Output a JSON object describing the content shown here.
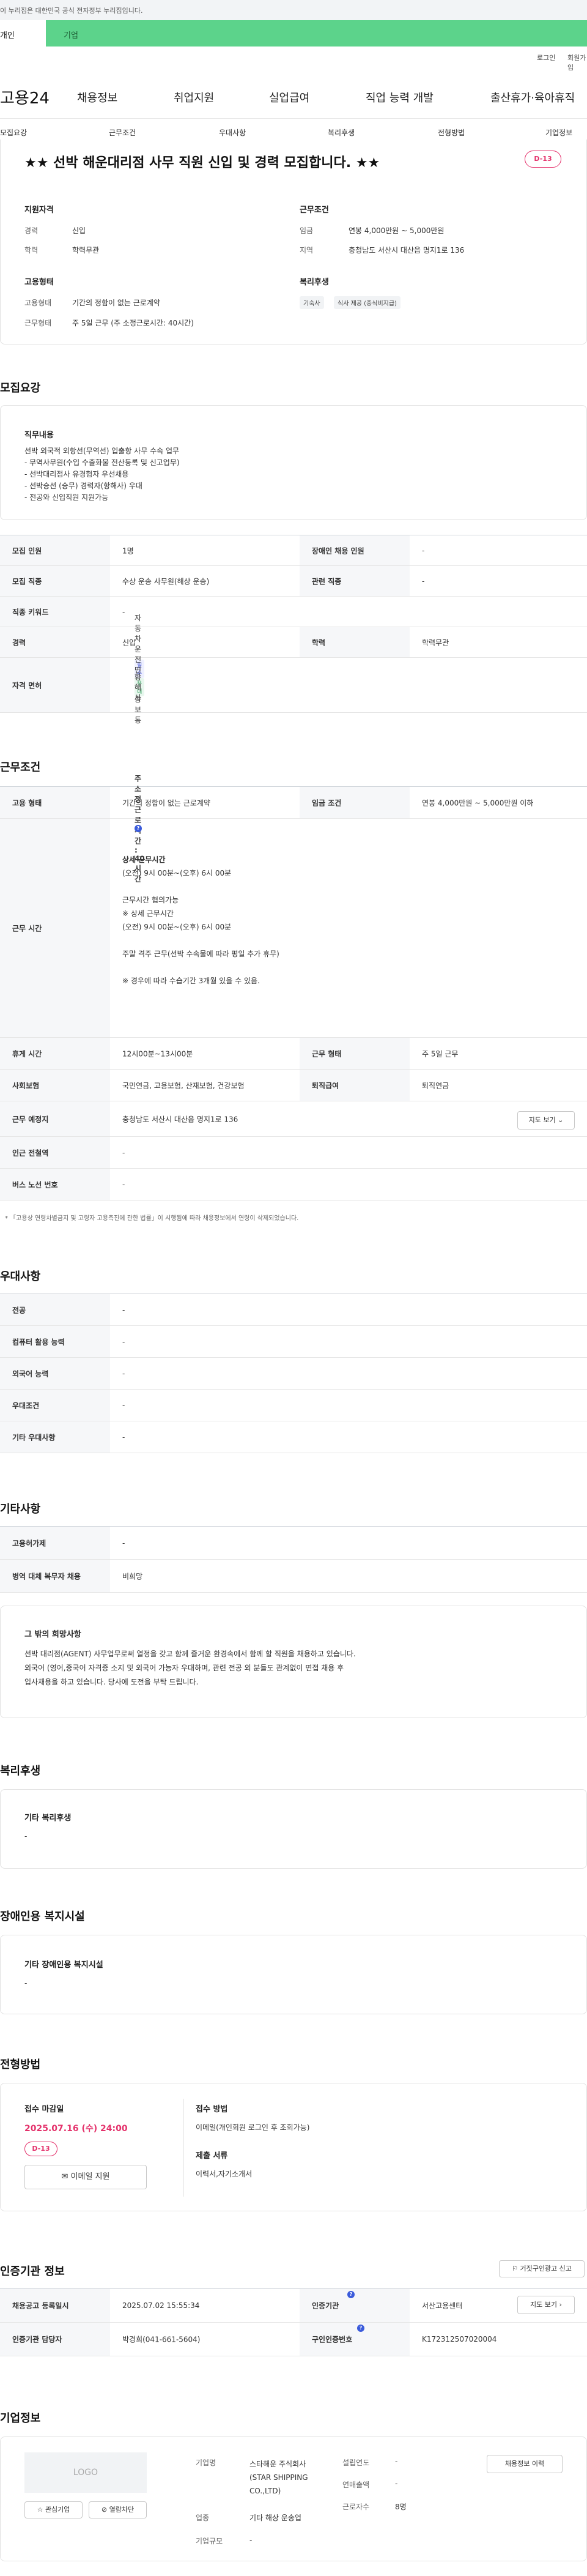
{
  "gov_banner": "이 누리집은 대한민국 공식 전자정부 누리집입니다.",
  "tabs": [
    "개인",
    "기업"
  ],
  "util": [
    "로그인",
    "회원가입"
  ],
  "logo": "고용24",
  "gnb": [
    "채용정보",
    "취업지원",
    "실업급여",
    "직업 능력 개발",
    "출산휴가·육아휴직"
  ],
  "subnav": [
    "모집요강",
    "근무조건",
    "우대사항",
    "복리후생",
    "전형방법",
    "기업정보"
  ],
  "job": {
    "title": "★★ 선박 해운대리점 사무 직원 신입 및 경력 모집합니다. ★★",
    "dday": "D-13",
    "qual_head": "지원자격",
    "qual": [
      {
        "k": "경력",
        "v": "신입"
      },
      {
        "k": "학력",
        "v": "학력무관"
      }
    ],
    "cond_head": "근무조건",
    "cond": [
      {
        "k": "임금",
        "v": "연봉 4,000만원 ~ 5,000만원"
      },
      {
        "k": "지역",
        "v": "충청남도 서산시 대산읍 명지1로 136"
      }
    ],
    "emp_head": "고용형태",
    "emp": [
      {
        "k": "고용형태",
        "v": "기간의 정함이 없는 근로계약"
      },
      {
        "k": "근무형태",
        "v": "주 5일 근무 (주 소정근로시간: 40시간)"
      }
    ],
    "welfare_head": "복리후생",
    "welfare": [
      "기숙사",
      "식사 제공 (중식비지급)"
    ]
  },
  "s1": {
    "title": "모집요강",
    "duty_head": "직무내용",
    "duty": [
      "선박 외국적 외항선(무역선) 입출항 사무 수속 업무",
      "- 무역사무원(수입 수출화물 전산등록 및 신고업무)",
      "- 선박대리점사 유경험자 우선채용",
      "- 선박승선 (승무) 경력자(항해사) 우대",
      "- 전공와 신입직원 지원가능"
    ],
    "rows": [
      {
        "a": "모집 인원",
        "b": "1명",
        "c": "장애인 채용 인원",
        "d": "-"
      },
      {
        "a": "모집 직종",
        "b": "수상 운송 사무원(해상 운송)",
        "c": "관련 직종",
        "d": "-"
      },
      {
        "a": "직종 키워드",
        "b": "-"
      },
      {
        "a": "경력",
        "b": "신입",
        "c": "학력",
        "d": "학력무관"
      }
    ],
    "license_k": "자격 면허",
    "license": [
      {
        "tag": "필수",
        "name": "자동차운전면허1종보통"
      },
      {
        "tag": "우대",
        "name": "항해사"
      }
    ]
  },
  "s2": {
    "title": "근무조건",
    "r1": {
      "a": "고용 형태",
      "b": "기간의 정함이 없는 근로계약",
      "c": "임금 조건",
      "d": "연봉 4,000만원 ~ 5,000만원 이하"
    },
    "time_k": "근무 시간",
    "time_top": "주 소정근로시간 : 40시간",
    "time_lines": [
      "상세 근무시간",
      "(오전) 9시 00분~(오후) 6시 00분",
      "",
      "근무시간 협의가능",
      "※ 상세 근무시간",
      "(오전) 9시 00분~(오후) 6시 00분",
      "",
      "주말 격주 근무(선박 수속물에 따라 평일 추가 휴무)",
      "",
      "※ 경우에 따라 수습기간 3개월 있을 수 있음."
    ],
    "r3": {
      "a": "휴게 시간",
      "b": "12시00분~13시00분",
      "c": "근무 형태",
      "d": "주 5일 근무"
    },
    "r4": {
      "a": "사회보험",
      "b": "국민연금, 고용보험, 산재보험, 건강보험",
      "c": "퇴직급여",
      "d": "퇴직연금"
    },
    "r5": {
      "a": "근무 예정지",
      "b": "충청남도 서산시 대산읍 명지1로 136",
      "btn": "지도 보기"
    },
    "r6": {
      "a": "인근 전철역",
      "b": "-"
    },
    "r7": {
      "a": "버스 노선 번호",
      "b": "-"
    },
    "note": "* 「고용상 연령차별금지 및 고령자 고용촉진에 관한 법률」이 시행됨에 따라 채용정보에서 연령이 삭제되었습니다."
  },
  "s3": {
    "title": "우대사항",
    "rows": [
      {
        "a": "전공",
        "b": "-"
      },
      {
        "a": "컴퓨터 활용 능력",
        "b": "-"
      },
      {
        "a": "외국어 능력",
        "b": "-"
      },
      {
        "a": "우대조건",
        "b": "-"
      },
      {
        "a": "기타 우대사항",
        "b": "-"
      }
    ]
  },
  "s4": {
    "title": "기타사항",
    "rows": [
      {
        "a": "고용허가제",
        "b": "-"
      },
      {
        "a": "병역 대체 복무자 채용",
        "b": "비희망"
      }
    ],
    "etc_head": "그 밖의 희망사항",
    "etc": [
      "선박 대리점(AGENT) 사무업무로써 열정을 갖고 함께 즐거운 환경속에서 함께 할 직원을 채용하고 있습니다.",
      "외국어 (영어,중국어 자격증 소지 및 외국어 가능자 우대하며, 관련 전공 외 분들도 관계없이 면접 채용 후",
      "입사채용을 하고 있습니다. 당사에 도전을 부탁 드립니다."
    ]
  },
  "s5": {
    "title": "복리후생",
    "head": "기타 복리후생",
    "val": "-"
  },
  "s6": {
    "title": "장애인용 복지시설",
    "head": "기타 장애인용 복지시설",
    "val": "-"
  },
  "s7": {
    "title": "전형방법",
    "deadline_head": "접수 마감일",
    "deadline": "2025.07.16 (수) 24:00",
    "dday": "D-13",
    "apply_btn": "이메일 지원",
    "method_head": "접수 방법",
    "method": "이메일(개인회원 로그인 후 조회가능)",
    "docs_head": "제출 서류",
    "docs": "이력서,자기소개서"
  },
  "s8": {
    "title": "인증기관 정보",
    "report_btn": "거짓구인광고 신고",
    "r1": {
      "a": "채용공고 등록일시",
      "b": "2025.07.02 15:55:34",
      "c": "인증기관",
      "d": "서산고용센터",
      "btn": "지도 보기"
    },
    "r2": {
      "a": "인증기관 담당자",
      "b": "박경희(041-661-5604)",
      "c": "구인인증번호",
      "d": "K172312507020004"
    }
  },
  "s9": {
    "title": "기업정보",
    "logo": "LOGO",
    "fav_btn": "관심기업",
    "block_btn": "열람차단",
    "info_btn": "채용정보 이력",
    "rows": [
      {
        "k": "기업명",
        "v": "스타해운 주식회사(STAR SHIPPING CO.,LTD)"
      },
      {
        "k": "업종",
        "v": "기타 해상 운송업"
      },
      {
        "k": "기업규모",
        "v": "-"
      }
    ],
    "rows2": [
      {
        "k": "설립연도",
        "v": "-"
      },
      {
        "k": "연매출액",
        "v": "-"
      },
      {
        "k": "근로자수",
        "v": "8명"
      }
    ]
  }
}
